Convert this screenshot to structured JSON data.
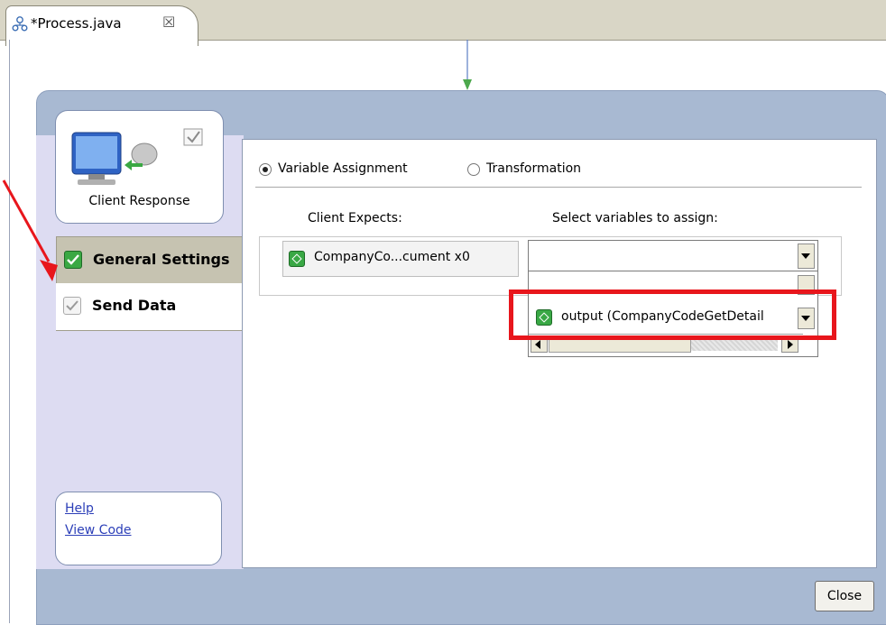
{
  "editor_tab": {
    "title": "*Process.java",
    "close_glyph": "☒"
  },
  "activity": {
    "name": "Client Response"
  },
  "nav": [
    {
      "label": "General Settings",
      "state": "checked-green",
      "selected": true
    },
    {
      "label": "Send Data",
      "state": "checked-gray",
      "selected": false
    }
  ],
  "links": {
    "help": "Help",
    "view_code": "View Code"
  },
  "mode": {
    "option_variable": "Variable Assignment",
    "option_transformation": "Transformation",
    "selected": "Variable Assignment"
  },
  "columns": {
    "client_expects": "Client Expects:",
    "select_vars": "Select variables to assign:"
  },
  "expects_item": "CompanyCo...cument x0",
  "combo": {
    "value": ""
  },
  "dropdown_items": [
    "output (CompanyCodeGetDetail"
  ],
  "close_label": "Close",
  "colors": {
    "highlight": "#e8161c",
    "accent_green": "#39a845",
    "dialog_bg": "#a8b9d2",
    "link": "#2c3fb8"
  }
}
